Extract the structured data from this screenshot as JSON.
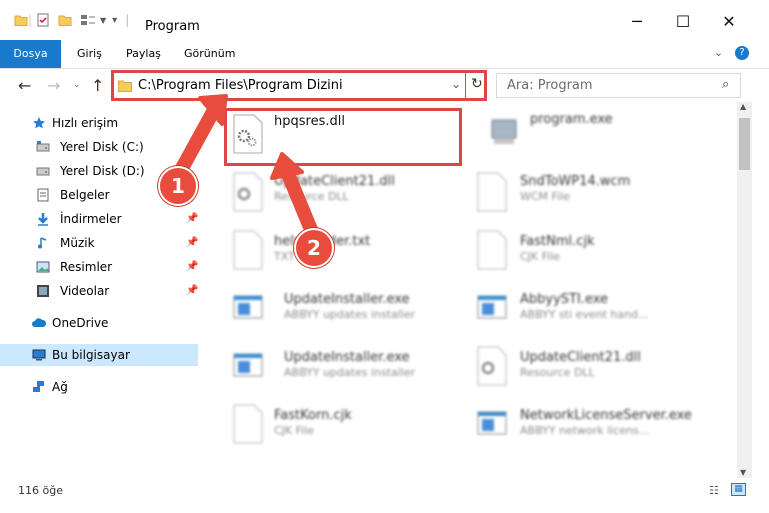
{
  "window": {
    "title": "Program",
    "minimize": "─",
    "maximize": "☐",
    "close": "✕"
  },
  "ribbon": {
    "tabs": [
      "Dosya",
      "Giriş",
      "Paylaş",
      "Görünüm"
    ]
  },
  "address": {
    "path": "C:\\Program Files\\Program Dizini",
    "search_placeholder": "Ara: Program"
  },
  "sidebar": {
    "items": [
      {
        "label": "Hızlı erişim",
        "icon": "star-icon"
      },
      {
        "label": "Yerel Disk (C:)",
        "icon": "drive-icon"
      },
      {
        "label": "Yerel Disk (D:)",
        "icon": "drive-icon"
      },
      {
        "label": "Belgeler",
        "icon": "documents-icon"
      },
      {
        "label": "İndirmeler",
        "icon": "download-icon",
        "pinned": true
      },
      {
        "label": "Müzik",
        "icon": "music-icon",
        "pinned": true
      },
      {
        "label": "Resimler",
        "icon": "pictures-icon",
        "pinned": true
      },
      {
        "label": "Videolar",
        "icon": "video-icon",
        "pinned": true
      },
      {
        "label": "OneDrive",
        "icon": "cloud-icon"
      },
      {
        "label": "Bu bilgisayar",
        "icon": "computer-icon",
        "selected": true
      },
      {
        "label": "Ağ",
        "icon": "network-icon"
      }
    ]
  },
  "files": [
    {
      "name": "hpqsres.dll",
      "desc": "",
      "icon": "dll-gear-icon"
    },
    {
      "name": "program.exe",
      "desc": "",
      "icon": "exe-icon"
    },
    {
      "name": "UpdateClient21.dll",
      "desc": "Resource DLL",
      "icon": "dll-gear-icon"
    },
    {
      "name": "SndToWP14.wcm",
      "desc": "WCM File",
      "icon": "file-icon"
    },
    {
      "name": "help-reader.txt",
      "desc": "TXT",
      "icon": "file-icon"
    },
    {
      "name": "FastNml.cjk",
      "desc": "CJK File",
      "icon": "file-icon"
    },
    {
      "name": "UpdateInstaller.exe",
      "desc": "ABBYY updates installer",
      "icon": "exe-window-icon"
    },
    {
      "name": "AbbyySTI.exe",
      "desc": "ABBYY sti event hand...",
      "icon": "exe-window-icon"
    },
    {
      "name": "UpdateInstaller.exe",
      "desc": "ABBYY updates installer",
      "icon": "exe-window-icon"
    },
    {
      "name": "UpdateClient21.dll",
      "desc": "Resource DLL",
      "icon": "dll-gear-icon"
    },
    {
      "name": "FastKorn.cjk",
      "desc": "CJK File",
      "icon": "file-icon"
    },
    {
      "name": "NetworkLicenseServer.exe",
      "desc": "ABBYY network licens...",
      "icon": "exe-window-icon"
    }
  ],
  "status": {
    "count": "116 öğe"
  },
  "annotations": {
    "step1": "1",
    "step2": "2"
  },
  "colors": {
    "accent": "#1979ca",
    "highlight_red": "#e04545",
    "selected_bg": "#cce8ff"
  }
}
